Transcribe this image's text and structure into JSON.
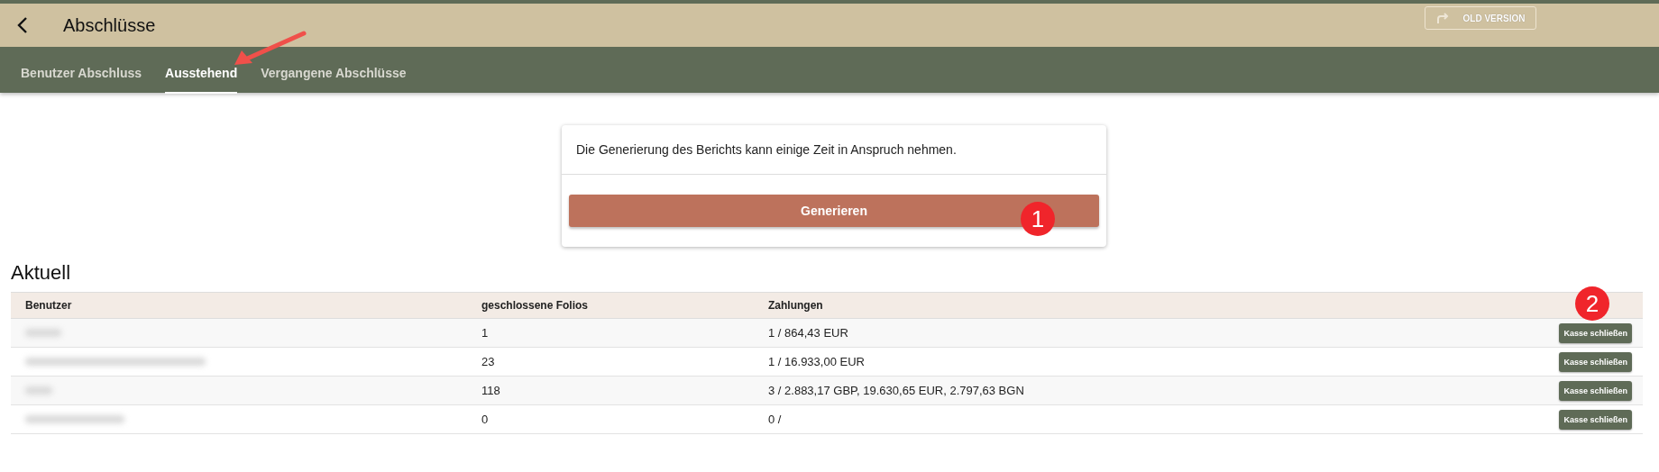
{
  "header": {
    "title": "Abschlüsse",
    "old_version_button": "OLD VERSION"
  },
  "tabs": [
    {
      "label": "Benutzer Abschluss",
      "selected": false
    },
    {
      "label": "Ausstehend",
      "selected": true
    },
    {
      "label": "Vergangene Abschlüsse",
      "selected": false
    }
  ],
  "report_card": {
    "message": "Die Generierung des Berichts kann einige Zeit in Anspruch nehmen.",
    "button": "Generieren"
  },
  "section_title": "Aktuell",
  "table": {
    "columns": [
      "Benutzer",
      "geschlossene Folios",
      "Zahlungen"
    ],
    "rows": [
      {
        "user_redacted": true,
        "folios": "1",
        "payments": "1 / 864,43 EUR",
        "action": "Kasse schließen"
      },
      {
        "user_redacted": true,
        "folios": "23",
        "payments": "1 / 16.933,00 EUR",
        "action": "Kasse schließen"
      },
      {
        "user_redacted": true,
        "folios": "118",
        "payments": "3 / 2.883,17 GBP, 19.630,65 EUR, 2.797,63 BGN",
        "action": "Kasse schließen"
      },
      {
        "user_redacted": true,
        "folios": "0",
        "payments": "0 /",
        "action": "Kasse schließen"
      }
    ]
  },
  "annotations": [
    {
      "kind": "arrow"
    },
    {
      "kind": "badge",
      "label": "1"
    },
    {
      "kind": "badge",
      "label": "2"
    }
  ]
}
